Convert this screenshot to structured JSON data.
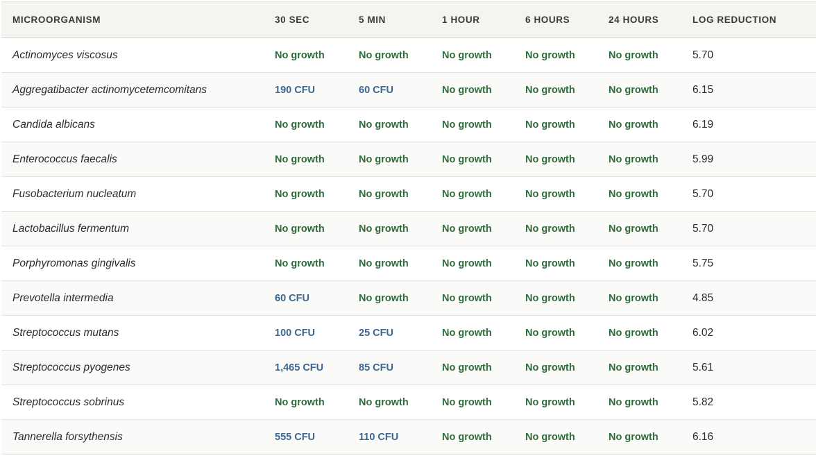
{
  "colors": {
    "no_growth": "#2e6b3a",
    "cfu": "#3c6590",
    "header_bg": "#f5f4f1"
  },
  "headers": [
    "MICROORGANISM",
    "30 SEC",
    "5 MIN",
    "1 HOUR",
    "6 HOURS",
    "24 HOURS",
    "LOG REDUCTION"
  ],
  "rows": [
    {
      "name": "Actinomyces viscosus",
      "t30s": "No growth",
      "t5m": "No growth",
      "t1h": "No growth",
      "t6h": "No growth",
      "t24h": "No growth",
      "log": "5.70"
    },
    {
      "name": "Aggregatibacter actinomycetemcomitans",
      "t30s": "190 CFU",
      "t5m": "60 CFU",
      "t1h": "No growth",
      "t6h": "No growth",
      "t24h": "No growth",
      "log": "6.15"
    },
    {
      "name": "Candida albicans",
      "t30s": "No growth",
      "t5m": "No growth",
      "t1h": "No growth",
      "t6h": "No growth",
      "t24h": "No growth",
      "log": "6.19"
    },
    {
      "name": "Enterococcus faecalis",
      "t30s": "No growth",
      "t5m": "No growth",
      "t1h": "No growth",
      "t6h": "No growth",
      "t24h": "No growth",
      "log": "5.99"
    },
    {
      "name": "Fusobacterium nucleatum",
      "t30s": "No growth",
      "t5m": "No growth",
      "t1h": "No growth",
      "t6h": "No growth",
      "t24h": "No growth",
      "log": "5.70"
    },
    {
      "name": "Lactobacillus fermentum",
      "t30s": "No growth",
      "t5m": "No growth",
      "t1h": "No growth",
      "t6h": "No growth",
      "t24h": "No growth",
      "log": "5.70"
    },
    {
      "name": "Porphyromonas gingivalis",
      "t30s": "No growth",
      "t5m": "No growth",
      "t1h": "No growth",
      "t6h": "No growth",
      "t24h": "No growth",
      "log": "5.75"
    },
    {
      "name": "Prevotella intermedia",
      "t30s": "60 CFU",
      "t5m": "No growth",
      "t1h": "No growth",
      "t6h": "No growth",
      "t24h": "No growth",
      "log": "4.85"
    },
    {
      "name": "Streptococcus mutans",
      "t30s": "100 CFU",
      "t5m": "25 CFU",
      "t1h": "No growth",
      "t6h": "No growth",
      "t24h": "No growth",
      "log": "6.02"
    },
    {
      "name": "Streptococcus pyogenes",
      "t30s": "1,465 CFU",
      "t5m": "85 CFU",
      "t1h": "No growth",
      "t6h": "No growth",
      "t24h": "No growth",
      "log": "5.61"
    },
    {
      "name": "Streptococcus sobrinus",
      "t30s": "No growth",
      "t5m": "No growth",
      "t1h": "No growth",
      "t6h": "No growth",
      "t24h": "No growth",
      "log": "5.82"
    },
    {
      "name": "Tannerella forsythensis",
      "t30s": "555 CFU",
      "t5m": "110 CFU",
      "t1h": "No growth",
      "t6h": "No growth",
      "t24h": "No growth",
      "log": "6.16"
    }
  ]
}
